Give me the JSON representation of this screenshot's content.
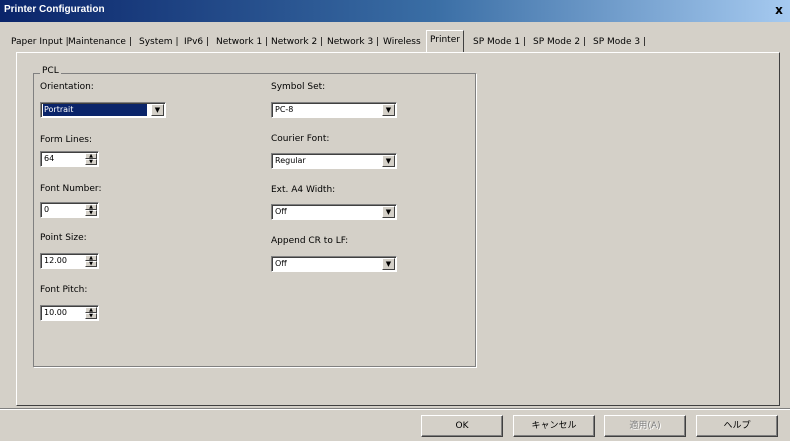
{
  "window": {
    "title": "Printer Configuration",
    "close_label": "x"
  },
  "tabs": [
    {
      "label": "Paper Input"
    },
    {
      "label": "Maintenance"
    },
    {
      "label": "System"
    },
    {
      "label": "IPv6"
    },
    {
      "label": "Network 1"
    },
    {
      "label": "Network 2"
    },
    {
      "label": "Network 3"
    },
    {
      "label": "Wireless"
    },
    {
      "label": "Printer"
    },
    {
      "label": "SP Mode 1"
    },
    {
      "label": "SP Mode 2"
    },
    {
      "label": "SP Mode 3"
    }
  ],
  "pcl": {
    "group_title": "PCL",
    "orientation": {
      "label": "Orientation:",
      "value": "Portrait"
    },
    "form_lines": {
      "label": "Form Lines:",
      "value": "64"
    },
    "font_number": {
      "label": "Font Number:",
      "value": "0"
    },
    "point_size": {
      "label": "Point Size:",
      "value": "12.00"
    },
    "font_pitch": {
      "label": "Font Pitch:",
      "value": "10.00"
    },
    "symbol_set": {
      "label": "Symbol Set:",
      "value": "PC-8"
    },
    "courier_font": {
      "label": "Courier Font:",
      "value": "Regular"
    },
    "ext_a4_width": {
      "label": "Ext. A4 Width:",
      "value": "Off"
    },
    "append_cr_to_lf": {
      "label": "Append CR to LF:",
      "value": "Off"
    }
  },
  "buttons": {
    "ok": "OK",
    "cancel": "キャンセル",
    "apply": "適用(A)",
    "help": "ヘルプ"
  }
}
